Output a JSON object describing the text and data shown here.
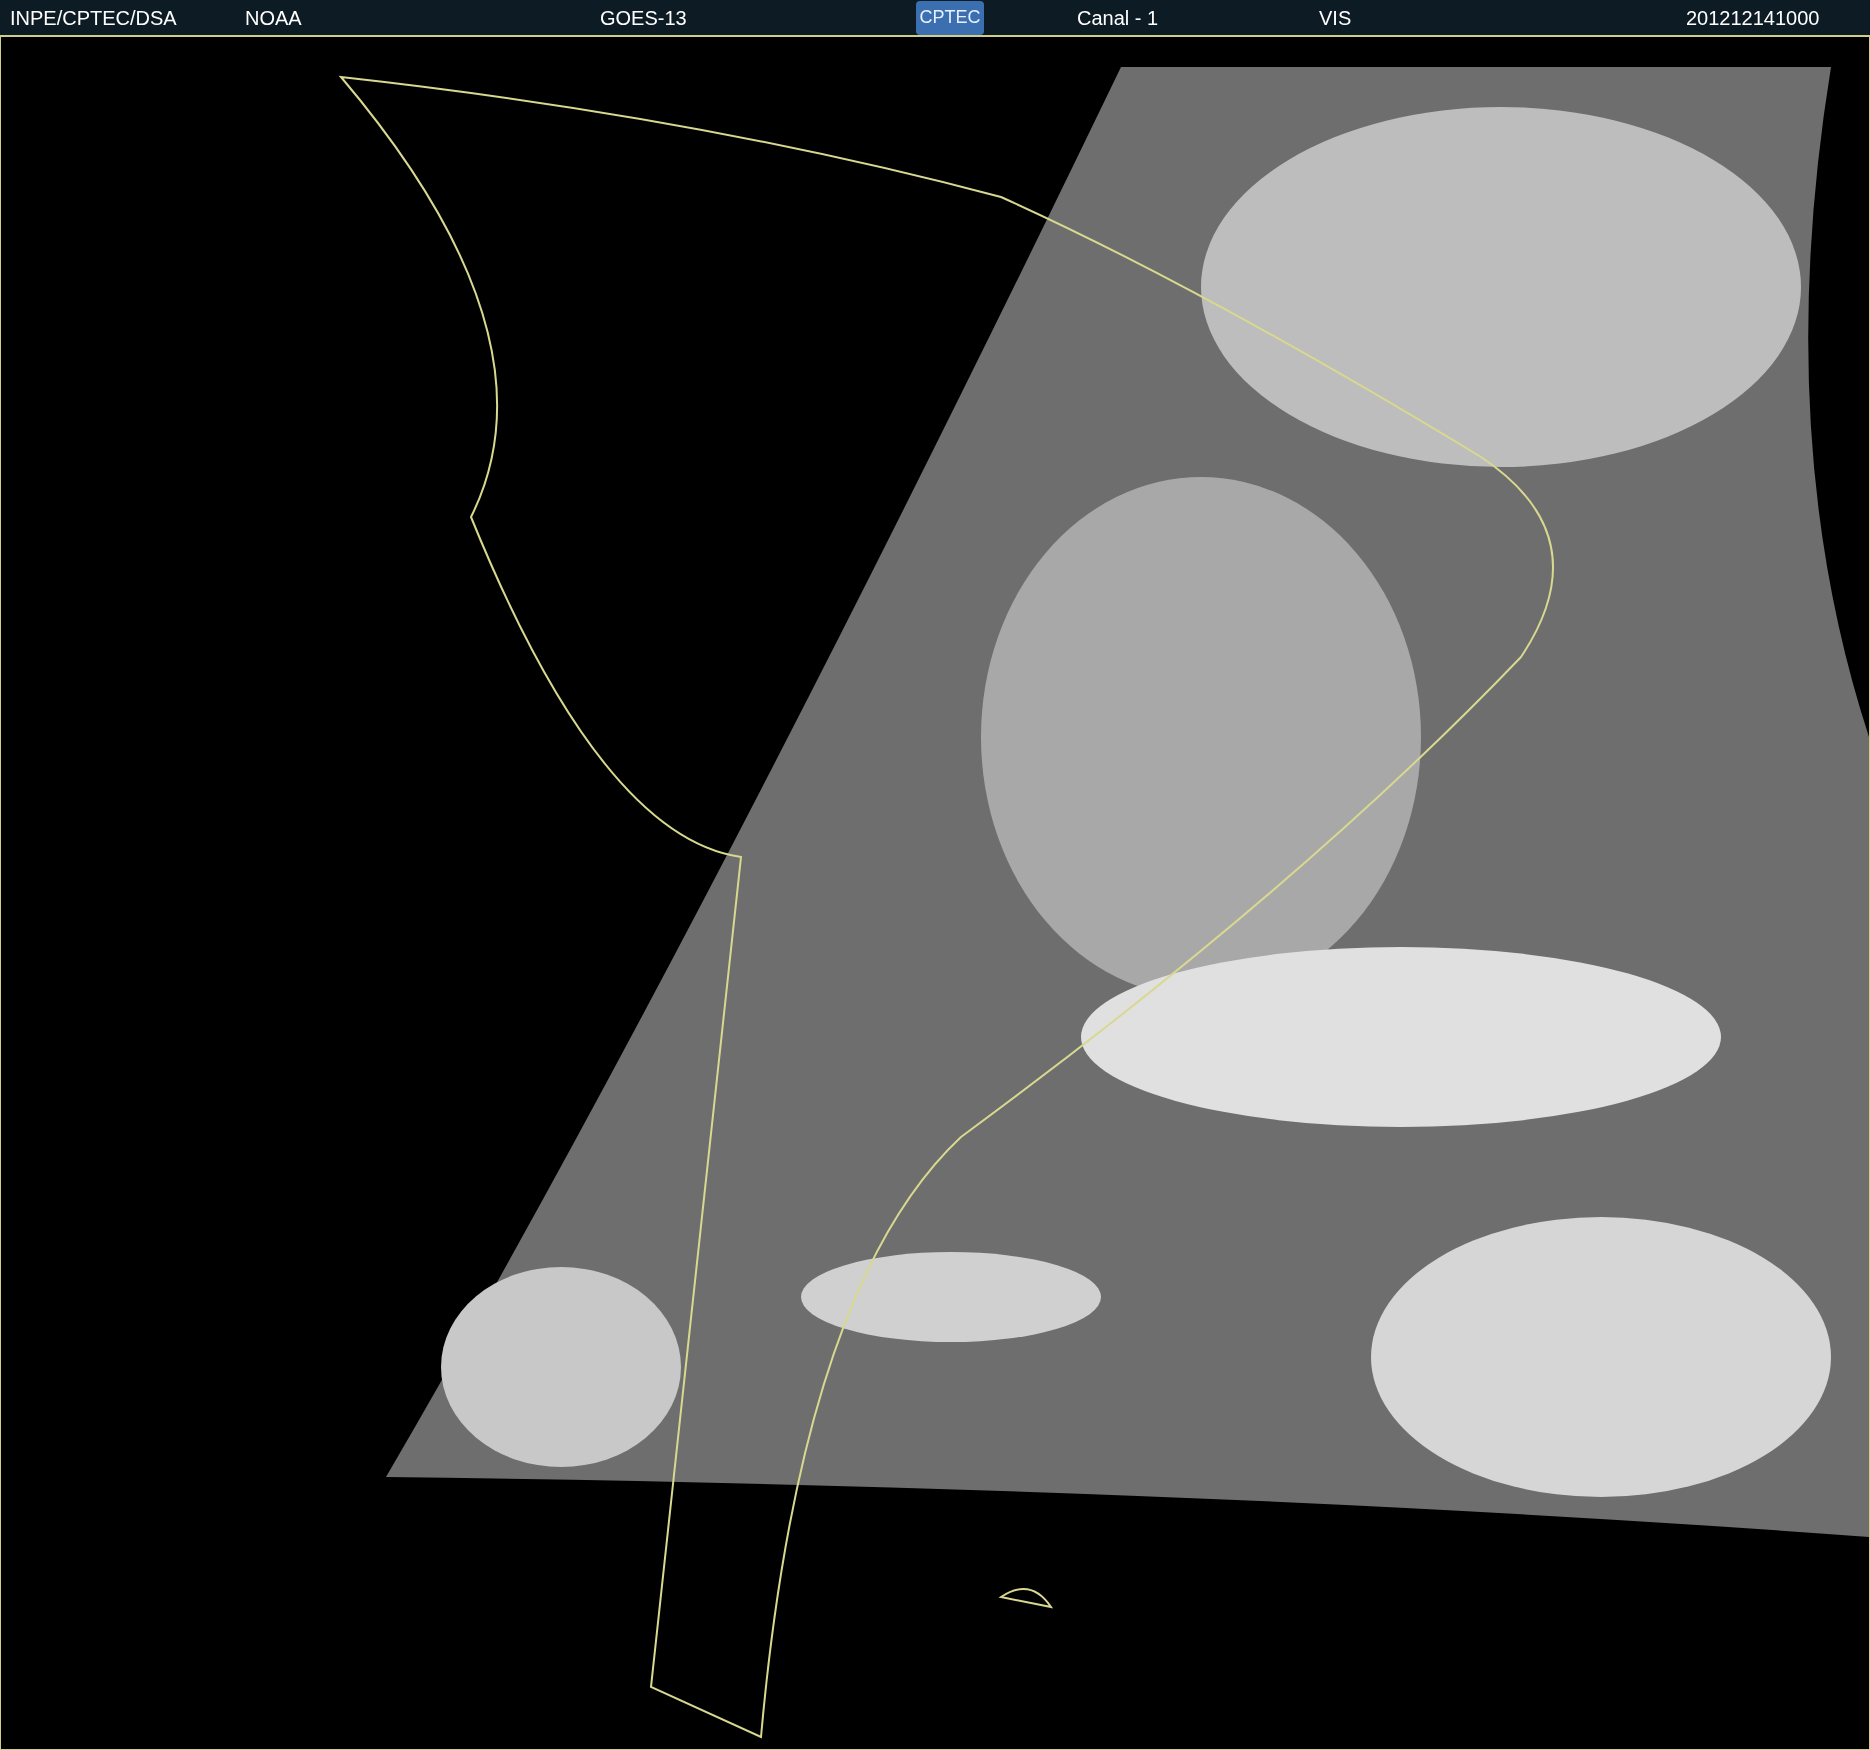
{
  "header": {
    "source": "INPE/CPTEC/DSA",
    "agency": "NOAA",
    "satellite": "GOES-13",
    "logo": "CPTEC",
    "channel": "Canal - 1",
    "band": "VIS",
    "timestamp": "201212141000"
  }
}
